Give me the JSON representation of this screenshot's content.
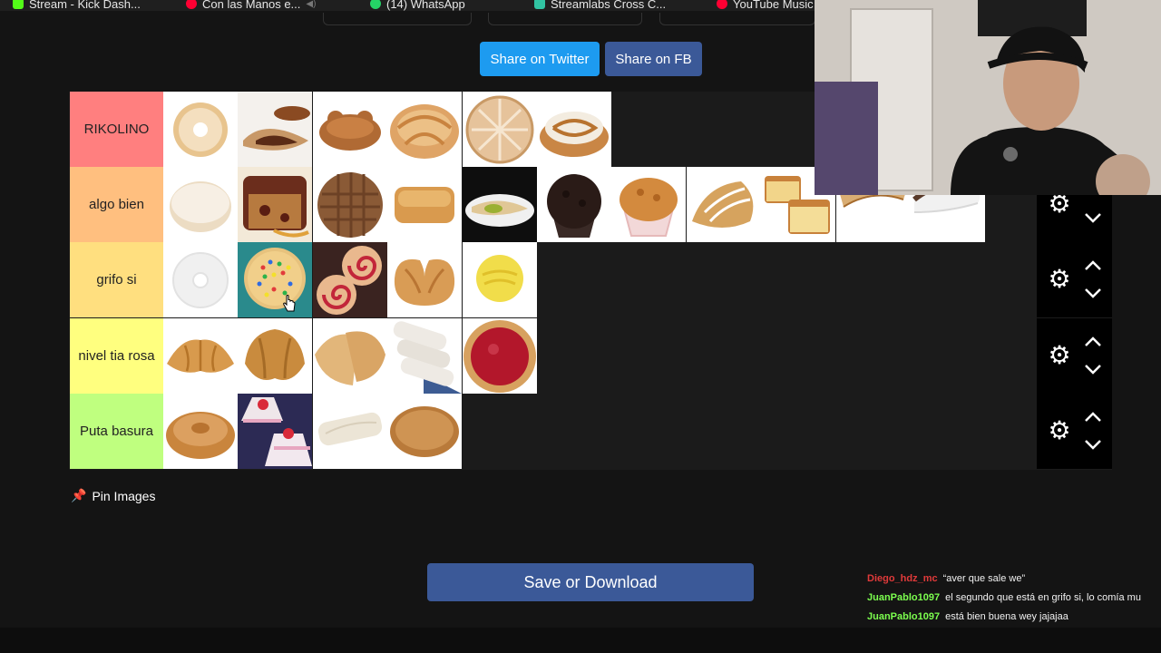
{
  "bookmarks": [
    {
      "label": "Stream - Kick Dash...",
      "icon": "kick-icon",
      "color": "#53fc18"
    },
    {
      "label": "Con las Manos e...",
      "icon": "youtube-music-icon",
      "color": "#ff0033",
      "muted": true
    },
    {
      "label": "(14) WhatsApp",
      "icon": "whatsapp-icon",
      "color": "#25d366"
    },
    {
      "label": "Streamlabs Cross C...",
      "icon": "streamlabs-icon",
      "color": "#31c3a2"
    },
    {
      "label": "YouTube Music",
      "icon": "youtube-music-icon",
      "color": "#ff0033"
    }
  ],
  "share": {
    "twitter": "Share on Twitter",
    "fb": "Share on FB"
  },
  "tiers": [
    {
      "label": "RIKOLINO",
      "color": "#ff7f7f",
      "count": 6
    },
    {
      "label": "algo bien",
      "color": "#ffbf7f",
      "count": 11
    },
    {
      "label": "grifo si",
      "color": "#ffdf7f",
      "count": 5
    },
    {
      "label": "nivel tia rosa",
      "color": "#ffff7f",
      "count": 5
    },
    {
      "label": "Puta basura",
      "color": "#bfff7f",
      "count": 4
    }
  ],
  "pin": {
    "label": "Pin Images",
    "icon": "pushpin-icon"
  },
  "save": {
    "label": "Save or Download"
  },
  "chat": [
    {
      "user": "Diego_hdz_mc",
      "color": "#e03a3a",
      "message": "“aver que sale we”"
    },
    {
      "user": "JuanPablo1097",
      "color": "#7cff4f",
      "message": "el segundo que está en grifo si, lo comía mu"
    },
    {
      "user": "JuanPablo1097",
      "color": "#7cff4f",
      "message": "está bien buena wey jajajaa"
    }
  ]
}
